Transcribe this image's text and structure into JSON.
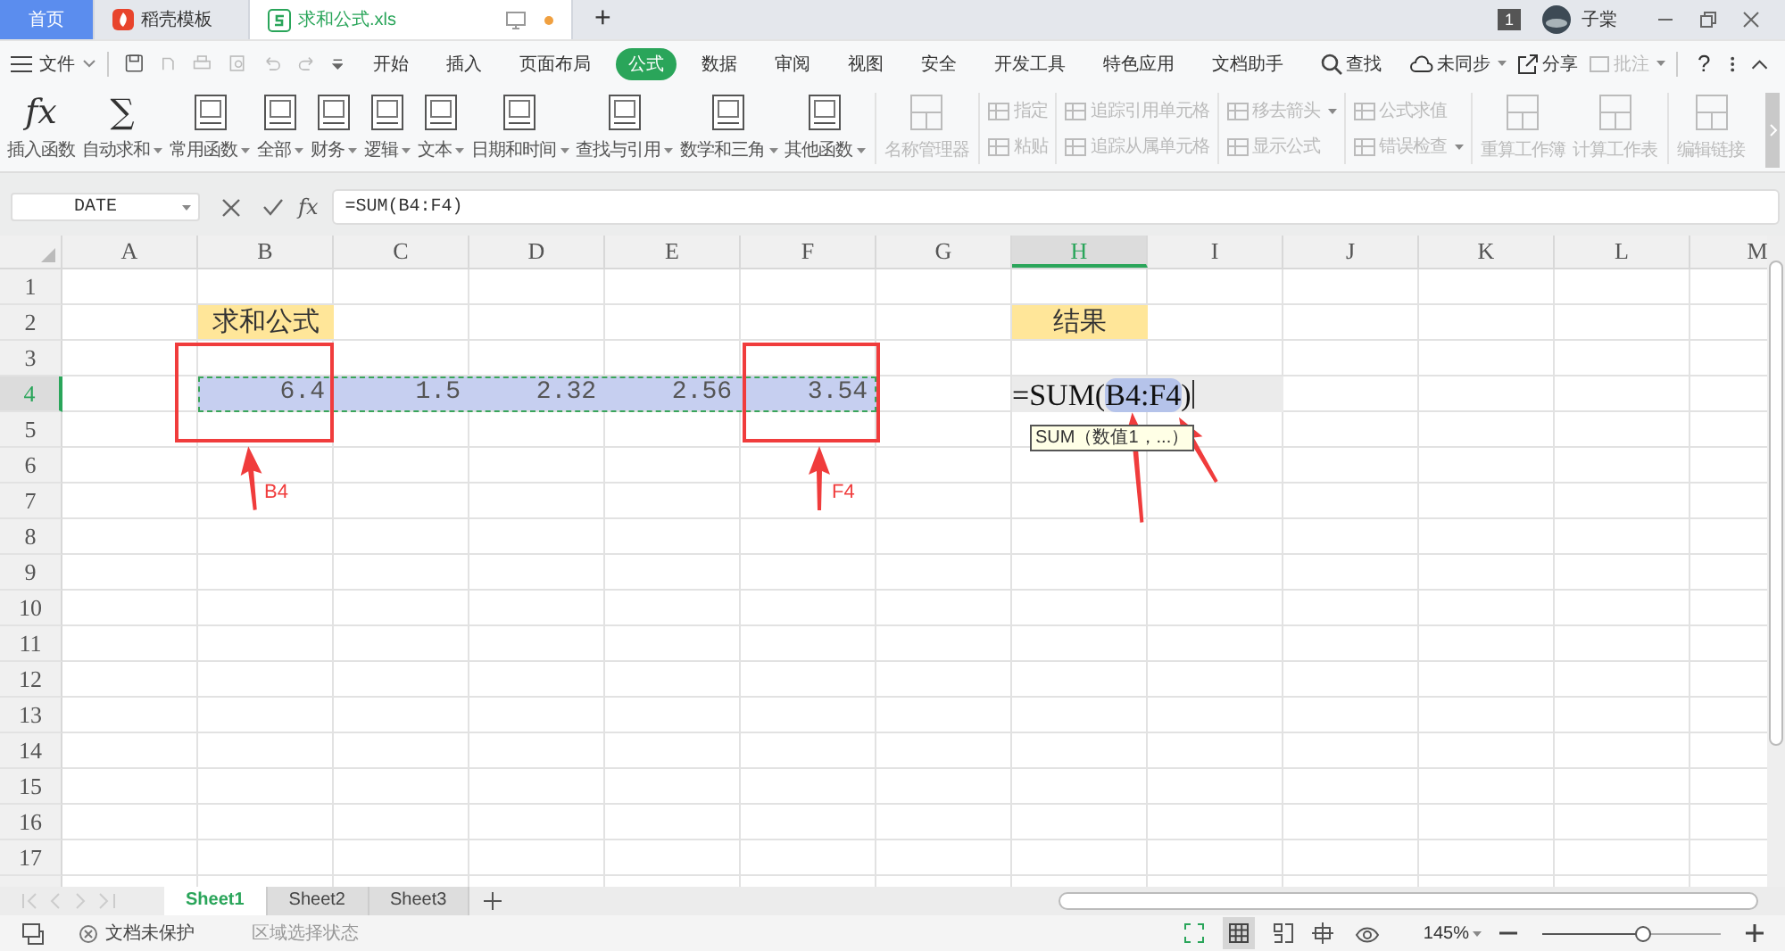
{
  "tabs": [
    {
      "label": "首页",
      "kind": "home",
      "selected": false
    },
    {
      "label": "稻壳模板",
      "kind": "docer",
      "selected": false
    },
    {
      "label": "求和公式.xls",
      "kind": "sheet",
      "selected": true
    }
  ],
  "new_tab": "+",
  "account": {
    "badge": "1",
    "user": "子棠"
  },
  "menu": {
    "file": "文件",
    "items": [
      {
        "label": "开始",
        "selected": false
      },
      {
        "label": "插入",
        "selected": false
      },
      {
        "label": "页面布局",
        "selected": false
      },
      {
        "label": "公式",
        "selected": true
      },
      {
        "label": "数据",
        "selected": false
      },
      {
        "label": "审阅",
        "selected": false
      },
      {
        "label": "视图",
        "selected": false
      },
      {
        "label": "安全",
        "selected": false
      },
      {
        "label": "开发工具",
        "selected": false
      },
      {
        "label": "特色应用",
        "selected": false
      },
      {
        "label": "文档助手",
        "selected": false
      }
    ],
    "search": "查找",
    "actions": [
      {
        "label": "未同步",
        "kind": "sync",
        "disabled": false,
        "dropdown": true
      },
      {
        "label": "分享",
        "kind": "share",
        "disabled": false,
        "dropdown": false
      },
      {
        "label": "批注",
        "kind": "comment",
        "disabled": true,
        "dropdown": true
      }
    ],
    "help": "?"
  },
  "ribbon": {
    "functions": [
      {
        "label": "插入函数",
        "kind": "glyph",
        "glyph": "fx",
        "dropdown": false
      },
      {
        "label": "自动求和",
        "kind": "glyph",
        "glyph": "∑",
        "dropdown": true
      },
      {
        "label": "常用函数",
        "kind": "book",
        "dropdown": true
      },
      {
        "label": "全部",
        "kind": "book",
        "dropdown": true
      },
      {
        "label": "财务",
        "kind": "book",
        "dropdown": true
      },
      {
        "label": "逻辑",
        "kind": "book",
        "dropdown": true
      },
      {
        "label": "文本",
        "kind": "book",
        "dropdown": true
      },
      {
        "label": "日期和时间",
        "kind": "book",
        "dropdown": true
      },
      {
        "label": "查找与引用",
        "kind": "book",
        "dropdown": true
      },
      {
        "label": "数学和三角",
        "kind": "book",
        "dropdown": true
      },
      {
        "label": "其他函数",
        "kind": "book",
        "dropdown": true
      }
    ],
    "groups": [
      {
        "kind": "large",
        "items": [
          {
            "label": "名称管理器",
            "disabled": true,
            "dropdown": false
          }
        ]
      },
      {
        "kind": "small",
        "items": [
          {
            "label": "指定",
            "disabled": true,
            "dropdown": false
          },
          {
            "label": "粘贴",
            "disabled": true,
            "dropdown": false
          }
        ]
      },
      {
        "kind": "small",
        "items": [
          {
            "label": "追踪引用单元格",
            "disabled": true,
            "dropdown": false
          },
          {
            "label": "追踪从属单元格",
            "disabled": true,
            "dropdown": false
          }
        ]
      },
      {
        "kind": "small",
        "items": [
          {
            "label": "移去箭头",
            "disabled": true,
            "dropdown": true
          },
          {
            "label": "显示公式",
            "disabled": true,
            "dropdown": false
          }
        ]
      },
      {
        "kind": "small",
        "items": [
          {
            "label": "公式求值",
            "disabled": true,
            "dropdown": false
          },
          {
            "label": "错误检查",
            "disabled": true,
            "dropdown": true
          }
        ]
      },
      {
        "kind": "large",
        "items": [
          {
            "label": "重算工作簿",
            "disabled": true,
            "dropdown": false
          },
          {
            "label": "计算工作表",
            "disabled": true,
            "dropdown": false
          }
        ]
      },
      {
        "kind": "large",
        "items": [
          {
            "label": "编辑链接",
            "disabled": true,
            "dropdown": false
          }
        ]
      }
    ]
  },
  "formula_bar": {
    "name_box": "DATE",
    "glyph": "fx",
    "formula": "=SUM(B4:F4)"
  },
  "sheet": {
    "columns": [
      {
        "label": "A",
        "selected": false
      },
      {
        "label": "B",
        "selected": false
      },
      {
        "label": "C",
        "selected": false
      },
      {
        "label": "D",
        "selected": false
      },
      {
        "label": "E",
        "selected": false
      },
      {
        "label": "F",
        "selected": false
      },
      {
        "label": "G",
        "selected": false
      },
      {
        "label": "H",
        "selected": true
      },
      {
        "label": "I",
        "selected": false
      },
      {
        "label": "J",
        "selected": false
      },
      {
        "label": "K",
        "selected": false
      },
      {
        "label": "L",
        "selected": false
      },
      {
        "label": "M",
        "selected": false
      }
    ],
    "rows": [
      {
        "label": "1",
        "selected": false,
        "cells": []
      },
      {
        "label": "2",
        "selected": false,
        "cells": [
          {
            "text": ""
          },
          {
            "text": "求和公式",
            "kind": "title",
            "selected": false
          },
          {
            "text": ""
          },
          {
            "text": ""
          },
          {
            "text": ""
          },
          {
            "text": ""
          },
          {
            "text": ""
          },
          {
            "text": "结果",
            "kind": "title",
            "selected": false
          }
        ]
      },
      {
        "label": "3",
        "selected": false,
        "cells": []
      },
      {
        "label": "4",
        "selected": true,
        "cells": [
          {
            "text": ""
          },
          {
            "text": "6.4",
            "kind": "number",
            "selected": true
          },
          {
            "text": "1.5",
            "kind": "number",
            "selected": true
          },
          {
            "text": "2.32",
            "kind": "number",
            "selected": true
          },
          {
            "text": "2.56",
            "kind": "number",
            "selected": true
          },
          {
            "text": "3.54",
            "kind": "number",
            "selected": true
          },
          {
            "text": ""
          },
          {
            "kind": "editing",
            "parts": [
              {
                "text": "=SUM(",
                "highlight": false
              },
              {
                "text": "B4:F4",
                "highlight": true
              },
              {
                "text": ")",
                "highlight": false
              }
            ],
            "tooltip": "SUM（数值1，...）"
          }
        ]
      },
      {
        "label": "5",
        "selected": false,
        "cells": []
      },
      {
        "label": "6",
        "selected": false,
        "cells": []
      },
      {
        "label": "7",
        "selected": false,
        "cells": []
      },
      {
        "label": "8",
        "selected": false,
        "cells": []
      },
      {
        "label": "9",
        "selected": false,
        "cells": []
      },
      {
        "label": "10",
        "selected": false,
        "cells": []
      },
      {
        "label": "11",
        "selected": false,
        "cells": []
      },
      {
        "label": "12",
        "selected": false,
        "cells": []
      },
      {
        "label": "13",
        "selected": false,
        "cells": []
      },
      {
        "label": "14",
        "selected": false,
        "cells": []
      },
      {
        "label": "15",
        "selected": false,
        "cells": []
      },
      {
        "label": "16",
        "selected": false,
        "cells": []
      },
      {
        "label": "17",
        "selected": false,
        "cells": []
      }
    ],
    "annotations": [
      {
        "kind": "box"
      },
      {
        "kind": "box"
      },
      {
        "kind": "arrow",
        "label": "B4"
      },
      {
        "kind": "arrow",
        "label": "F4"
      },
      {
        "kind": "arrow"
      },
      {
        "kind": "arrow"
      }
    ]
  },
  "sheet_tabs": [
    {
      "label": "Sheet1",
      "selected": true
    },
    {
      "label": "Sheet2",
      "selected": false
    },
    {
      "label": "Sheet3",
      "selected": false
    }
  ],
  "status_bar": {
    "protection": "文档未保护",
    "mode": "区域选择状态",
    "zoom": "145%",
    "zoom_slider": {
      "level": 0.57
    }
  }
}
